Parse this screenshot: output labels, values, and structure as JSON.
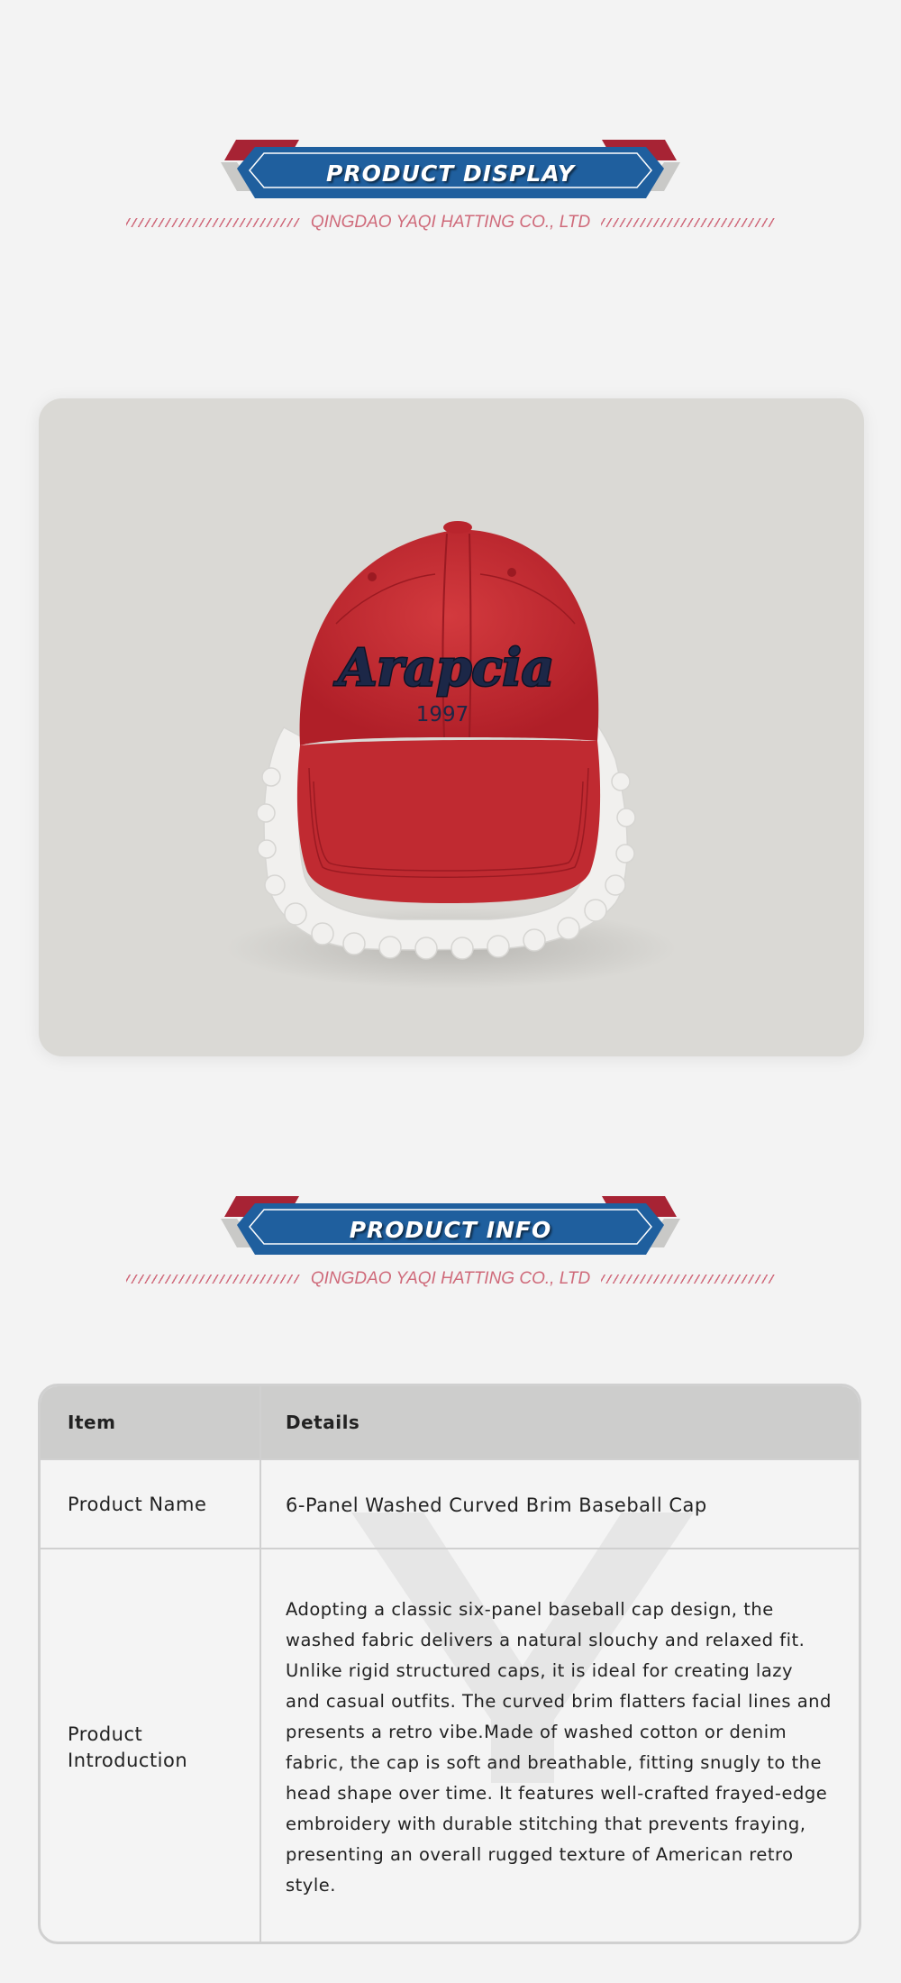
{
  "sections": {
    "display": {
      "title": "PRODUCT DISPLAY",
      "company": "QINGDAO YAQI HATTING CO., LTD"
    },
    "info": {
      "title": "PRODUCT INFO",
      "company": "QINGDAO YAQI HATTING CO., LTD"
    }
  },
  "product_image": {
    "embroidery_text": "Arapcia",
    "embroidery_year": "1997",
    "cap_color": "#c4262e"
  },
  "table": {
    "header": {
      "item": "Item",
      "details": "Details"
    },
    "rows": [
      {
        "item": "Product Name",
        "details": "6-Panel Washed Curved Brim Baseball Cap"
      },
      {
        "item": "Product Introduction",
        "details": "Adopting a classic six-panel baseball cap design, the washed fabric delivers a natural slouchy and relaxed fit. Unlike rigid structured caps, it is ideal for creating lazy and casual outfits. The curved brim flatters facial lines and presents a retro vibe.Made of washed cotton or denim fabric, the cap is soft and breathable, fitting snugly to the head shape over time. It features well-crafted frayed-edge embroidery with durable stitching that prevents fraying, presenting an overall rugged texture of American retro style."
      }
    ]
  },
  "colors": {
    "banner_blue": "#1f5f9e",
    "banner_red": "#a72334",
    "accent_pink": "#cf6a7a",
    "background": "#f3f3f3"
  }
}
